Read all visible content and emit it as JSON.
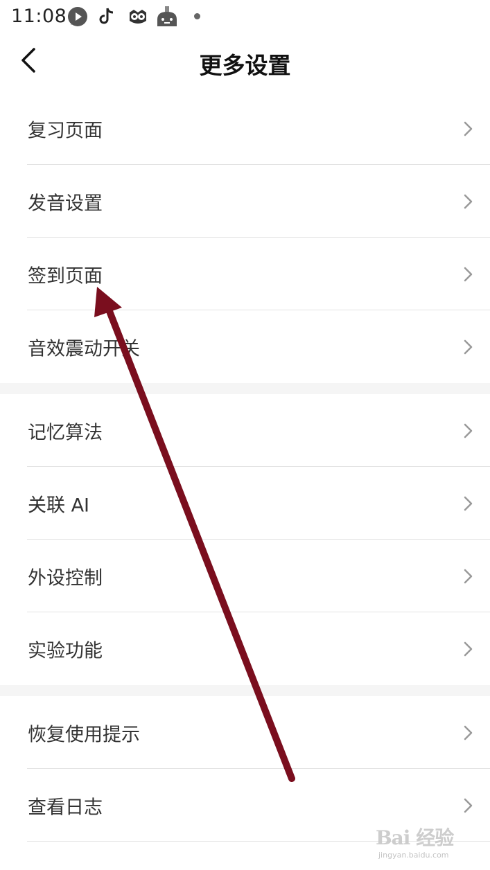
{
  "status_bar": {
    "time": "11:08",
    "icons": [
      "chat-bubble-icon",
      "tiktok-icon",
      "owl-icon",
      "robot-icon",
      "notification-dot-icon"
    ]
  },
  "header": {
    "title": "更多设置",
    "back_icon": "chevron-left-icon"
  },
  "groups": [
    {
      "items": [
        {
          "label": "复习页面"
        },
        {
          "label": "发音设置"
        },
        {
          "label": "签到页面"
        },
        {
          "label": "音效震动开关"
        }
      ]
    },
    {
      "items": [
        {
          "label": "记忆算法"
        },
        {
          "label": "关联 AI"
        },
        {
          "label": "外设控制"
        },
        {
          "label": "实验功能"
        }
      ]
    },
    {
      "items": [
        {
          "label": "恢复使用提示"
        },
        {
          "label": "查看日志"
        }
      ]
    }
  ],
  "colors": {
    "annotation_arrow": "#7a0e1e",
    "divider": "#e3e3e3",
    "section_gap": "#f5f5f5"
  },
  "watermark": {
    "text": "Bai 经验",
    "sub": "jingyan.baidu.com"
  }
}
